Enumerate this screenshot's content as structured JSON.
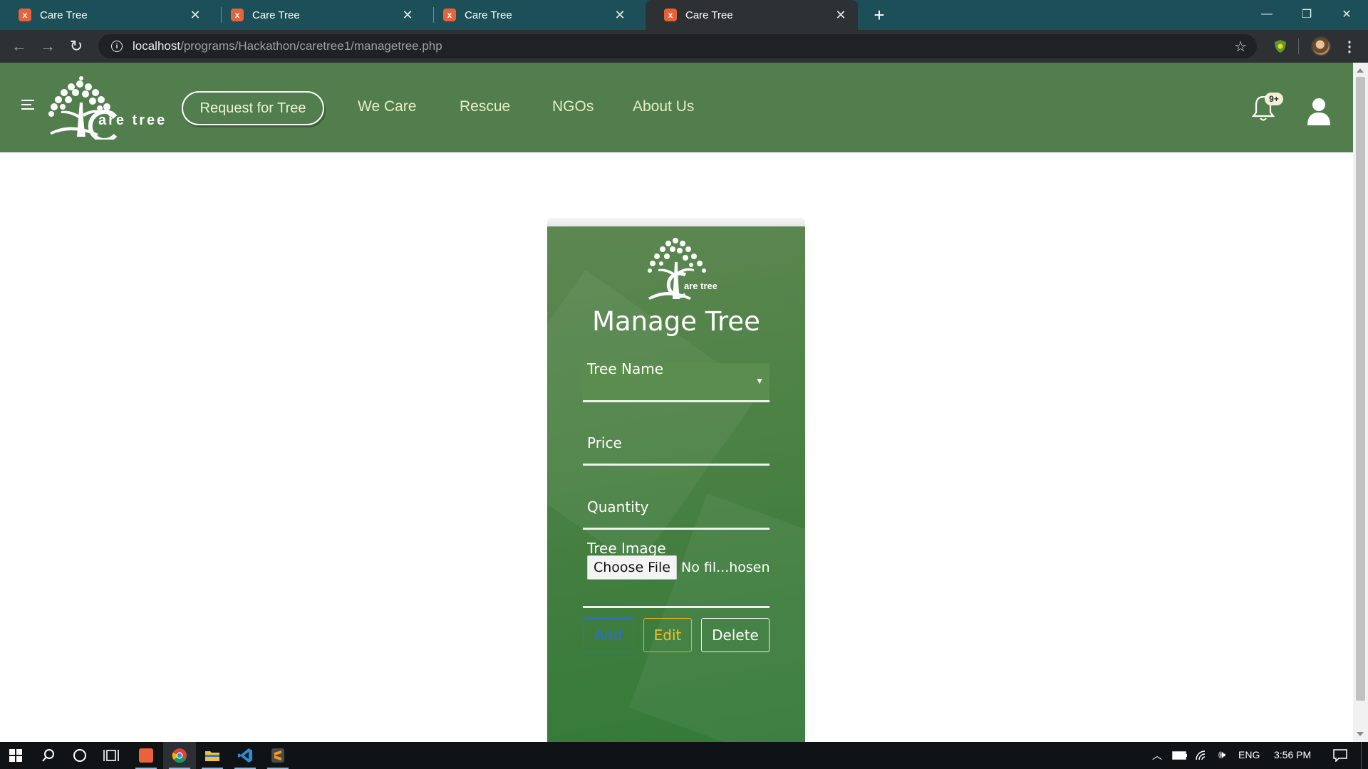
{
  "browser": {
    "tabs": [
      {
        "title": "Care Tree",
        "active": false
      },
      {
        "title": "Care Tree",
        "active": false
      },
      {
        "title": "Care Tree",
        "active": false
      },
      {
        "title": "Care Tree",
        "active": true
      }
    ],
    "url_host": "localhost",
    "url_path": "/programs/Hackathon/caretree1/managetree.php"
  },
  "site_nav": {
    "brand": "are tree",
    "request_button": "Request for Tree",
    "links": [
      "We Care",
      "Rescue",
      "NGOs",
      "About Us"
    ],
    "notification_badge": "9+"
  },
  "form": {
    "logo_text": "are tree",
    "title": "Manage Tree",
    "tree_name_label": "Tree Name",
    "price_label": "Price",
    "quantity_label": "Quantity",
    "image_label": "Tree Image",
    "choose_file": "Choose File",
    "file_status": "No fil...hosen",
    "buttons": {
      "add": "Add",
      "edit": "Edit",
      "delete": "Delete"
    }
  },
  "taskbar": {
    "language": "ENG",
    "time": "3:56 PM"
  },
  "colors": {
    "tabstrip": "#1c4f57",
    "navbar": "#517e4c",
    "card": "#4f8347",
    "add": "#2a6fd6",
    "edit": "#f3c21f"
  }
}
